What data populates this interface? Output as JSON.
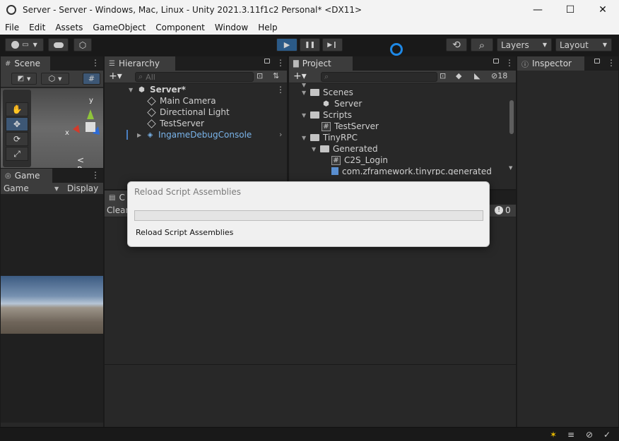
{
  "window": {
    "title": "Server - Server - Windows, Mac, Linux - Unity 2021.3.11f1c2 Personal* <DX11>",
    "minimize": "—",
    "maximize": "☐",
    "close": "✕"
  },
  "menu": [
    "File",
    "Edit",
    "Assets",
    "GameObject",
    "Component",
    "Window",
    "Help"
  ],
  "toolbar": {
    "account_icon": "account-icon",
    "cloud_icon": "cloud-icon",
    "collab_icon": "collab-icon",
    "play_icon": "▶",
    "pause_icon": "❚❚",
    "step_icon": "▶❙",
    "history_icon": "⟲",
    "search_icon": "⌕",
    "layers_label": "Layers",
    "layout_label": "Layout"
  },
  "scene_panel": {
    "tab_label": "Scene",
    "persp_label": "< Persp",
    "axis_y": "y",
    "axis_x": "x"
  },
  "game_panel": {
    "tab_label": "Game",
    "game_dropdown": "Game",
    "display_label": "Display"
  },
  "hierarchy": {
    "tab_label": "Hierarchy",
    "search_placeholder": "All",
    "items": [
      {
        "label": "Server*",
        "type": "scene"
      },
      {
        "label": "Main Camera",
        "type": "object"
      },
      {
        "label": "Directional Light",
        "type": "object"
      },
      {
        "label": "TestServer",
        "type": "object"
      },
      {
        "label": "IngameDebugConsole",
        "type": "prefab"
      }
    ]
  },
  "project": {
    "tab_label": "Project",
    "hidden_count": "18",
    "items": [
      {
        "label": "Scenes",
        "type": "folder"
      },
      {
        "label": "Server",
        "type": "scene"
      },
      {
        "label": "Scripts",
        "type": "folder"
      },
      {
        "label": "TestServer",
        "type": "script"
      },
      {
        "label": "TinyRPC",
        "type": "folder"
      },
      {
        "label": "Generated",
        "type": "folder"
      },
      {
        "label": "C2S_Login",
        "type": "script"
      },
      {
        "label": "com.zframework.tinyrpc.generated",
        "type": "asmdef"
      }
    ]
  },
  "inspector": {
    "tab_label": "Inspector"
  },
  "console": {
    "tab_label": "C",
    "clear_label": "Clear",
    "error_count": "0"
  },
  "dialog": {
    "title": "Reload Script Assemblies",
    "message": "Reload Script Assemblies",
    "progress": 0.0
  },
  "colors": {
    "accent": "#2b5a87",
    "prefab_text": "#7ab4ea"
  }
}
